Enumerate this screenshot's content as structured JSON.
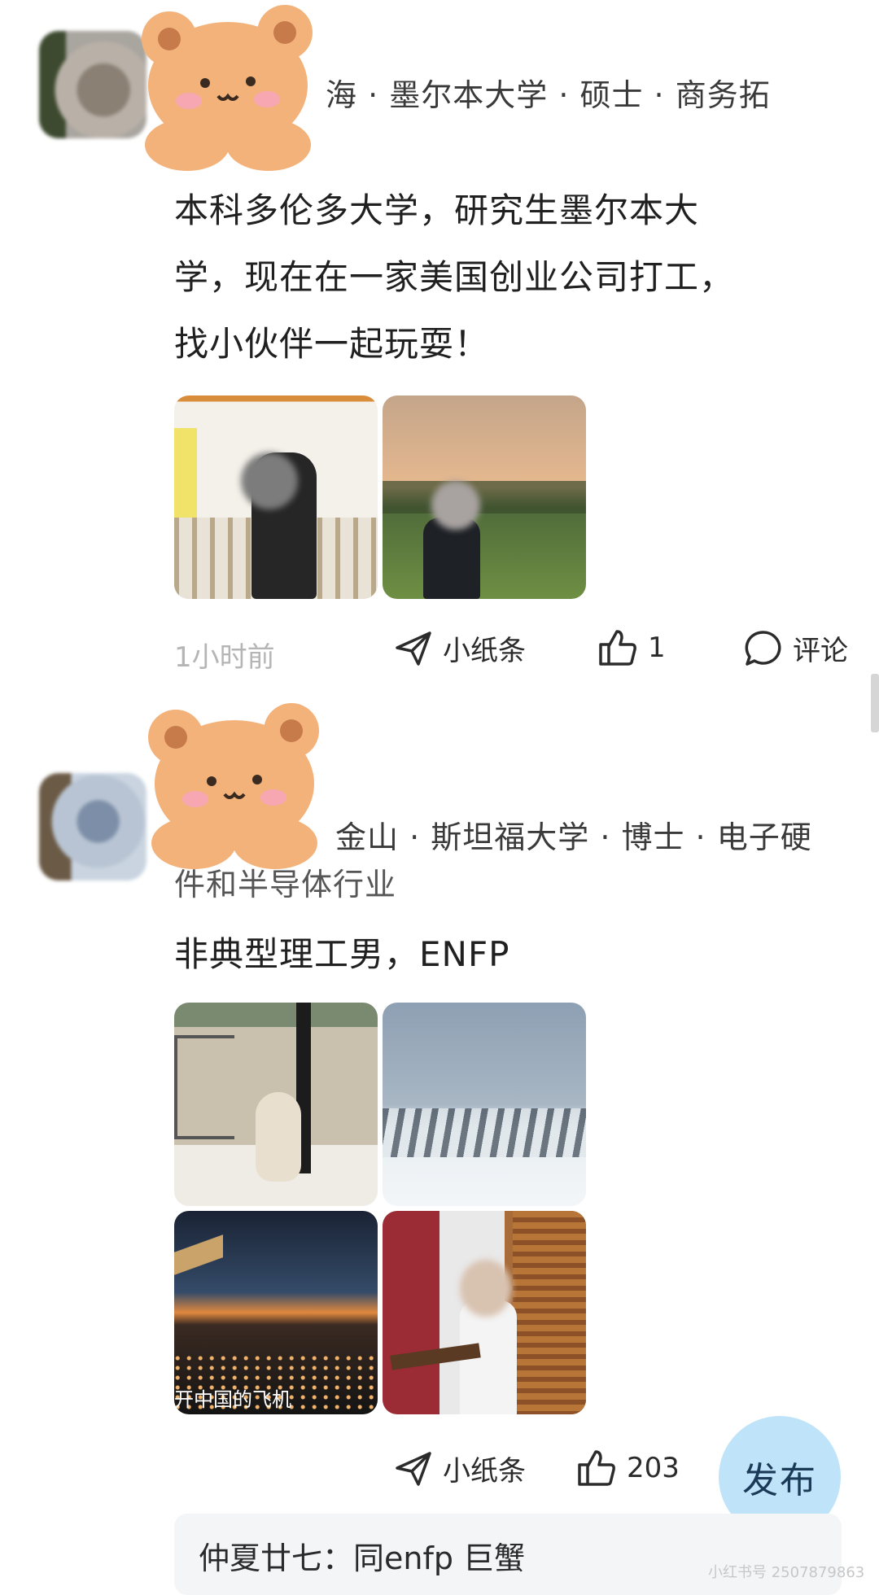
{
  "posts": [
    {
      "meta_visible": "海 · 墨尔本大学 · 硕士 · 商务拓",
      "text_lines": [
        "本科多伦多大学，研究生墨尔本大",
        "学，现在在一家美国创业公司打工，",
        "找小伙伴一起玩耍！"
      ],
      "time": "1小时前",
      "note_label": "小纸条",
      "like_count": "1",
      "comment_label": "评论"
    },
    {
      "meta_visible_line1": "金山 · 斯坦福大学 · 博士 · 电子硬",
      "meta_visible_line2": "件和半导体行业",
      "text": "非典型理工男，ENFP",
      "photo_caption": "开中国的飞机",
      "note_label": "小纸条",
      "like_count": "203"
    }
  ],
  "publish_button": "发布",
  "comment_preview": "仲夏廿七：同enfp 巨蟹",
  "watermark": "小红书号 2507879863",
  "icons": [
    "paper-plane-icon",
    "thumbs-up-icon",
    "comment-bubble-icon",
    "bear-sticker-icon"
  ]
}
